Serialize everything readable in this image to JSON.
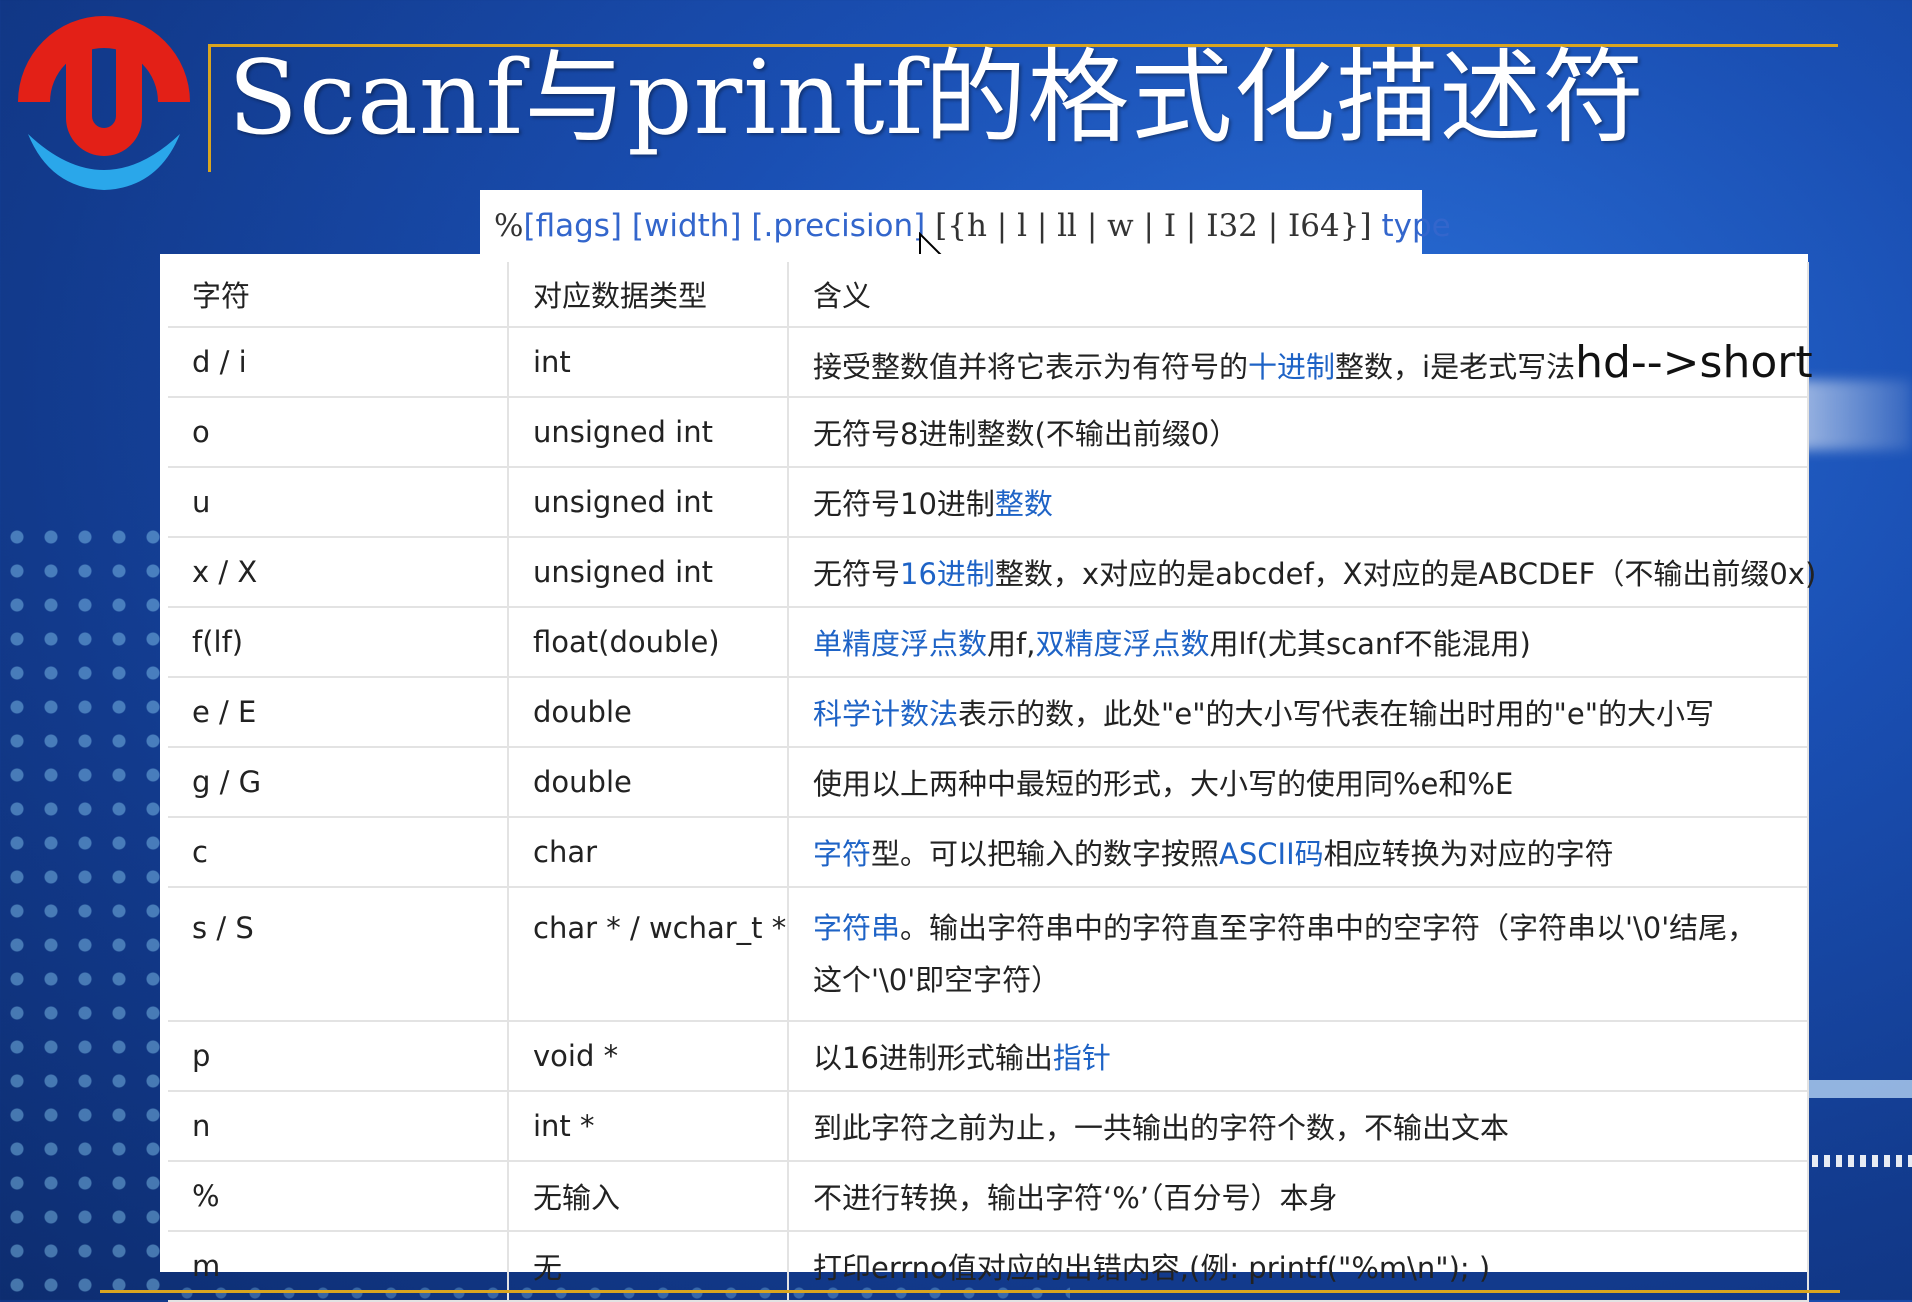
{
  "title": "Scanf与printf的格式化描述符",
  "syntax": {
    "prefix": "%",
    "flags": "[flags]",
    "width": "[width]",
    "precision": "[.precision]",
    "size_open": "[{h",
    "size_rest": "| l | ll | w | I | I32 | I64}]",
    "type": "type"
  },
  "table": {
    "headers": [
      "字符",
      "对应数据类型",
      "含义"
    ],
    "rows": [
      {
        "char": "d / i",
        "type": "int",
        "m1": "接受整数值并将它表示为有符号的",
        "l1": "十进制",
        "m2": "整数，i是老式写法",
        "extra": "hd-->short"
      },
      {
        "char": "o",
        "type": "unsigned int",
        "m1": "无符号8进制整数(不输出前缀0）"
      },
      {
        "char": "u",
        "type": "unsigned int",
        "m1": "无符号10进制",
        "l1": "整数"
      },
      {
        "char": "x / X",
        "type": "unsigned int",
        "m1": "无符号",
        "l1": "16进制",
        "m2": "整数，x对应的是abcdef，X对应的是ABCDEF（不输出前缀0x)"
      },
      {
        "char": "f(lf)",
        "type": "float(double)",
        "l1": "单精度浮点数",
        "m1": "用f,",
        "l2": "双精度浮点数",
        "m2": "用lf(尤其scanf不能混用)"
      },
      {
        "char": "e / E",
        "type": "double",
        "l1": "科学计数法",
        "m1": "表示的数，此处\"e\"的大小写代表在输出时用的\"e\"的大小写"
      },
      {
        "char": "g / G",
        "type": "double",
        "m1": "使用以上两种中最短的形式，大小写的使用同%e和%E"
      },
      {
        "char": "c",
        "type": "char",
        "l1": "字符",
        "m1": "型。可以把输入的数字按照",
        "l2": "ASCII码",
        "m2": "相应转换为对应的字符"
      },
      {
        "char": "s / S",
        "type": "char * / wchar_t *",
        "l1": "字符串",
        "m1": "。输出字符串中的字符直至字符串中的空字符（字符串以'\\0'结尾，这个'\\0'即空字符）"
      },
      {
        "char": "p",
        "type": "void *",
        "m1": "以16进制形式输出",
        "l1": "指针"
      },
      {
        "char": "n",
        "type": "int *",
        "m1": "到此字符之前为止，一共输出的字符个数，不输出文本"
      },
      {
        "char": "%",
        "type": "无输入",
        "m1": "不进行转换，输出字符‘%’（百分号）本身"
      },
      {
        "char": "m",
        "type": "无",
        "m1": "打印errno值对应的出错内容,(例: printf(\"%m\\n\"); )"
      }
    ]
  }
}
